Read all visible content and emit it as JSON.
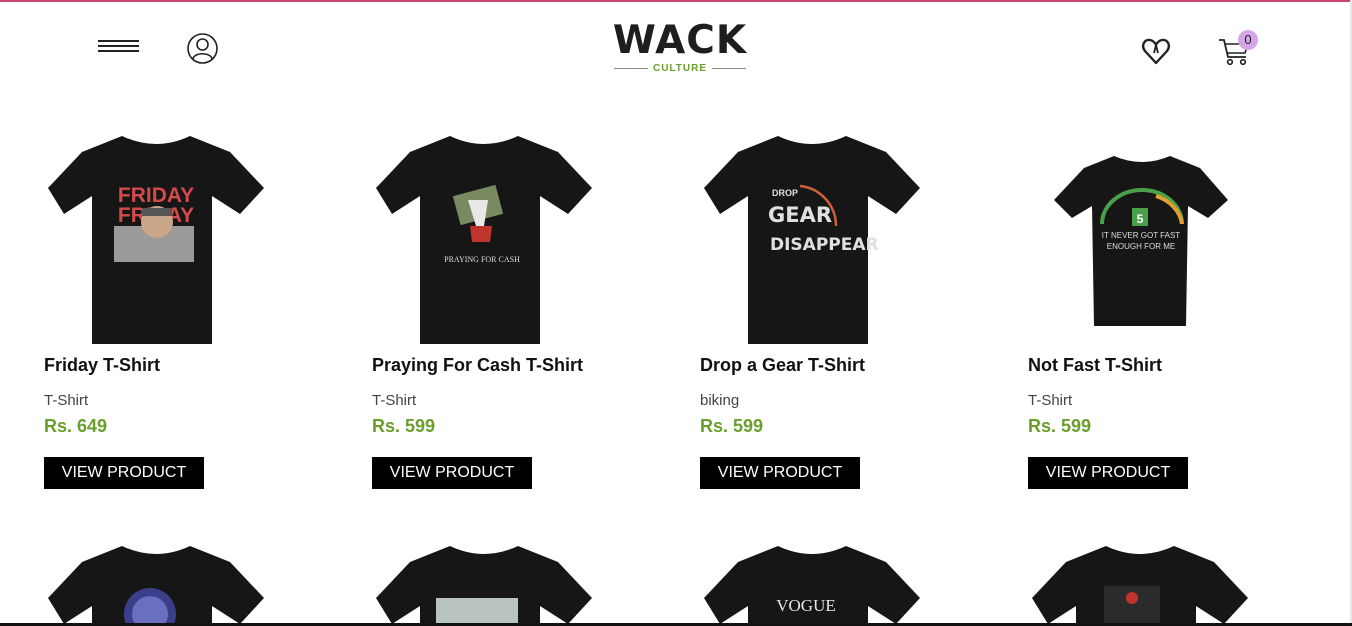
{
  "header": {
    "brand": "WACK",
    "brand_sub": "CULTURE",
    "cart_count": "0",
    "icons": [
      "menu-icon",
      "user-icon",
      "heart-icon",
      "cart-icon"
    ]
  },
  "colors": {
    "accent": "#6a9f2c",
    "badge": "#d6a6e8",
    "topline": "#c8456e"
  },
  "products": [
    {
      "name": "Friday T-Shirt",
      "category": "T-Shirt",
      "price": "Rs. 649",
      "button": "VIEW PRODUCT",
      "print": "FRIDAY"
    },
    {
      "name": "Praying For Cash T-Shirt",
      "category": "T-Shirt",
      "price": "Rs. 599",
      "button": "VIEW PRODUCT",
      "print": "PRAYING FOR CASH"
    },
    {
      "name": "Drop a Gear T-Shirt",
      "category": "biking",
      "price": "Rs. 599",
      "button": "VIEW PRODUCT",
      "print_top": "DROP",
      "print_mid": "GEAR",
      "print_bot": "DISAPPEAR"
    },
    {
      "name": "Not Fast T-Shirt",
      "category": "T-Shirt",
      "price": "Rs. 599",
      "button": "VIEW PRODUCT",
      "print": "IT NEVER GOT FAST ENOUGH FOR ME"
    }
  ],
  "row2": {
    "vogue": "VOGUE"
  }
}
